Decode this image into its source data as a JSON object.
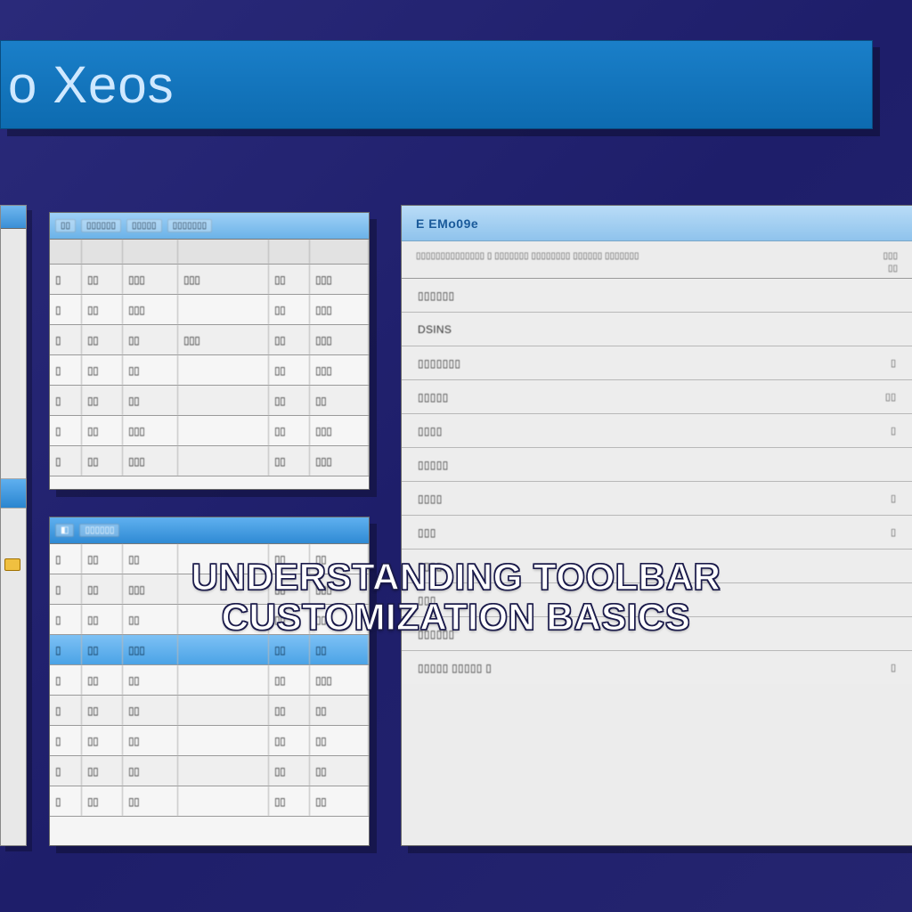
{
  "title_bar": {
    "text": "o Xeos"
  },
  "caption": {
    "line1": "Understanding Toolbar",
    "line2": "Customization Basics"
  },
  "sheet_a": {
    "header_segments": [
      "▯▯",
      "▯▯▯▯▯▯",
      "▯▯▯▯▯",
      "▯▯▯▯▯▯▯"
    ],
    "columns": [
      "",
      "",
      "",
      "",
      "",
      ""
    ],
    "rows": [
      [
        "▯",
        "▯▯",
        "▯▯▯",
        "▯▯▯",
        "▯▯",
        "▯▯▯"
      ],
      [
        "▯",
        "▯▯",
        "▯▯▯",
        "",
        "▯▯",
        "▯▯▯"
      ],
      [
        "▯",
        "▯▯",
        "▯▯",
        "▯▯▯",
        "▯▯",
        "▯▯▯"
      ],
      [
        "▯",
        "▯▯",
        "▯▯",
        "",
        "▯▯",
        "▯▯▯"
      ],
      [
        "▯",
        "▯▯",
        "▯▯",
        "",
        "▯▯",
        "▯▯"
      ],
      [
        "▯",
        "▯▯",
        "▯▯▯",
        "",
        "▯▯",
        "▯▯▯"
      ],
      [
        "▯",
        "▯▯",
        "▯▯▯",
        "",
        "▯▯",
        "▯▯▯"
      ]
    ]
  },
  "sheet_b": {
    "header_segments": [
      "◧",
      "▯▯▯▯▯▯"
    ],
    "rows": [
      [
        "▯",
        "▯▯",
        "▯▯",
        "",
        "▯▯",
        "▯▯"
      ],
      [
        "▯",
        "▯▯",
        "▯▯▯",
        "",
        "▯▯",
        "▯▯▯"
      ],
      [
        "▯",
        "▯▯",
        "▯▯",
        "",
        "▯▯",
        "▯▯"
      ],
      [
        "▯",
        "▯▯",
        "▯▯▯",
        "",
        "▯▯",
        "▯▯"
      ],
      [
        "▯",
        "▯▯",
        "▯▯",
        "",
        "▯▯",
        "▯▯▯"
      ],
      [
        "▯",
        "▯▯",
        "▯▯",
        "",
        "▯▯",
        "▯▯"
      ],
      [
        "▯",
        "▯▯",
        "▯▯",
        "",
        "▯▯",
        "▯▯"
      ],
      [
        "▯",
        "▯▯",
        "▯▯",
        "",
        "▯▯",
        "▯▯"
      ],
      [
        "▯",
        "▯▯",
        "▯▯",
        "",
        "▯▯",
        "▯▯"
      ]
    ],
    "selected_index": 3
  },
  "settings": {
    "title": "E EMo09e",
    "desc_left": "▯▯▯▯▯▯▯▯▯▯▯▯▯▯ ▯ ▯▯▯▯▯▯▯ ▯▯▯▯▯▯▯▯ ▯▯▯▯▯▯ ▯▯▯▯▯▯▯",
    "desc_right_a": "▯▯▯",
    "desc_right_b": "▯▯",
    "items": [
      {
        "label": "▯▯▯▯▯▯",
        "value": ""
      },
      {
        "label": "Dsins",
        "value": ""
      },
      {
        "label": "▯▯▯▯▯▯▯",
        "value": "▯"
      },
      {
        "label": "▯▯▯▯▯",
        "value": "▯▯"
      },
      {
        "label": "▯▯▯▯",
        "value": "▯"
      },
      {
        "label": "▯▯▯▯▯",
        "value": ""
      },
      {
        "label": "▯▯▯▯",
        "value": "▯"
      },
      {
        "label": "▯▯▯",
        "value": "▯"
      },
      {
        "label": "▯▯▯▯",
        "value": ""
      },
      {
        "label": "▯▯▯",
        "value": ""
      },
      {
        "label": "▯▯▯▯▯▯",
        "value": ""
      },
      {
        "label": "▯▯▯▯▯ ▯▯▯▯▯ ▯",
        "value": "▯"
      }
    ]
  }
}
